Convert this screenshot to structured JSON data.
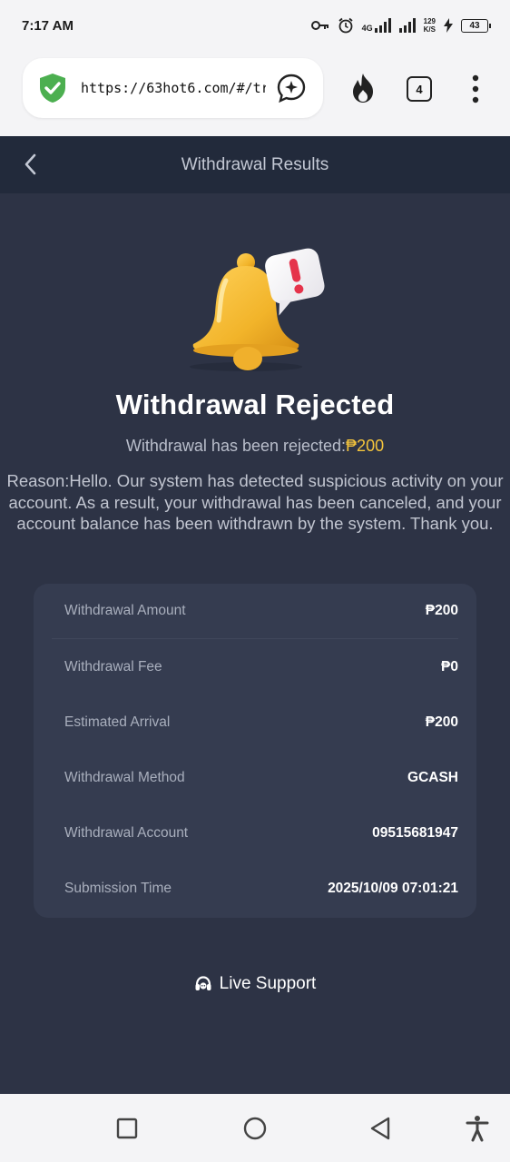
{
  "status_bar": {
    "time": "7:17 AM",
    "network_label": "4G",
    "net_speed_top": "129",
    "net_speed_bottom": "K/S",
    "battery": "43"
  },
  "browser": {
    "url": "https://63hot6.com/#/tran",
    "tab_count": "4"
  },
  "header": {
    "title": "Withdrawal Results"
  },
  "result": {
    "title": "Withdrawal Rejected",
    "subtitle_prefix": "Withdrawal has been rejected:",
    "subtitle_amount": "₱200",
    "reason": "Reason:Hello. Our system has detected suspicious activity on your account. As a result, your withdrawal has been canceled, and your account balance has been withdrawn by the system. Thank you."
  },
  "details": [
    {
      "label": "Withdrawal Amount",
      "value": "₱200"
    },
    {
      "label": "Withdrawal Fee",
      "value": "₱0"
    },
    {
      "label": "Estimated Arrival",
      "value": "₱200"
    },
    {
      "label": "Withdrawal Method",
      "value": "GCASH"
    },
    {
      "label": "Withdrawal Account",
      "value": "09515681947"
    },
    {
      "label": "Submission Time",
      "value": "2025/10/09 07:01:21"
    }
  ],
  "support": {
    "label": "Live Support"
  },
  "colors": {
    "accent_amount": "#f5c53c",
    "page_bg": "#2d3345",
    "header_bg": "#222a3b",
    "card_bg": "#353c50",
    "secure_green": "#4caf50"
  },
  "icons": [
    "shield-check-icon",
    "ai-chat-icon",
    "fire-icon",
    "menu-dots-icon",
    "back-chevron-icon",
    "bell-alert-icon",
    "headset-icon",
    "square-nav-icon",
    "circle-nav-icon",
    "triangle-back-nav-icon",
    "accessibility-icon"
  ]
}
